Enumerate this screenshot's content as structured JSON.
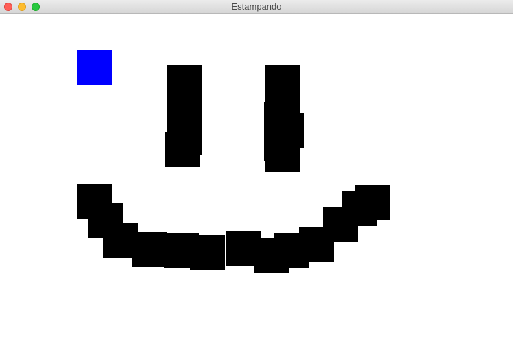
{
  "window": {
    "title": "Estampando"
  },
  "colors": {
    "cursor_stamp": "#0000ff",
    "stamp": "#000000"
  }
}
